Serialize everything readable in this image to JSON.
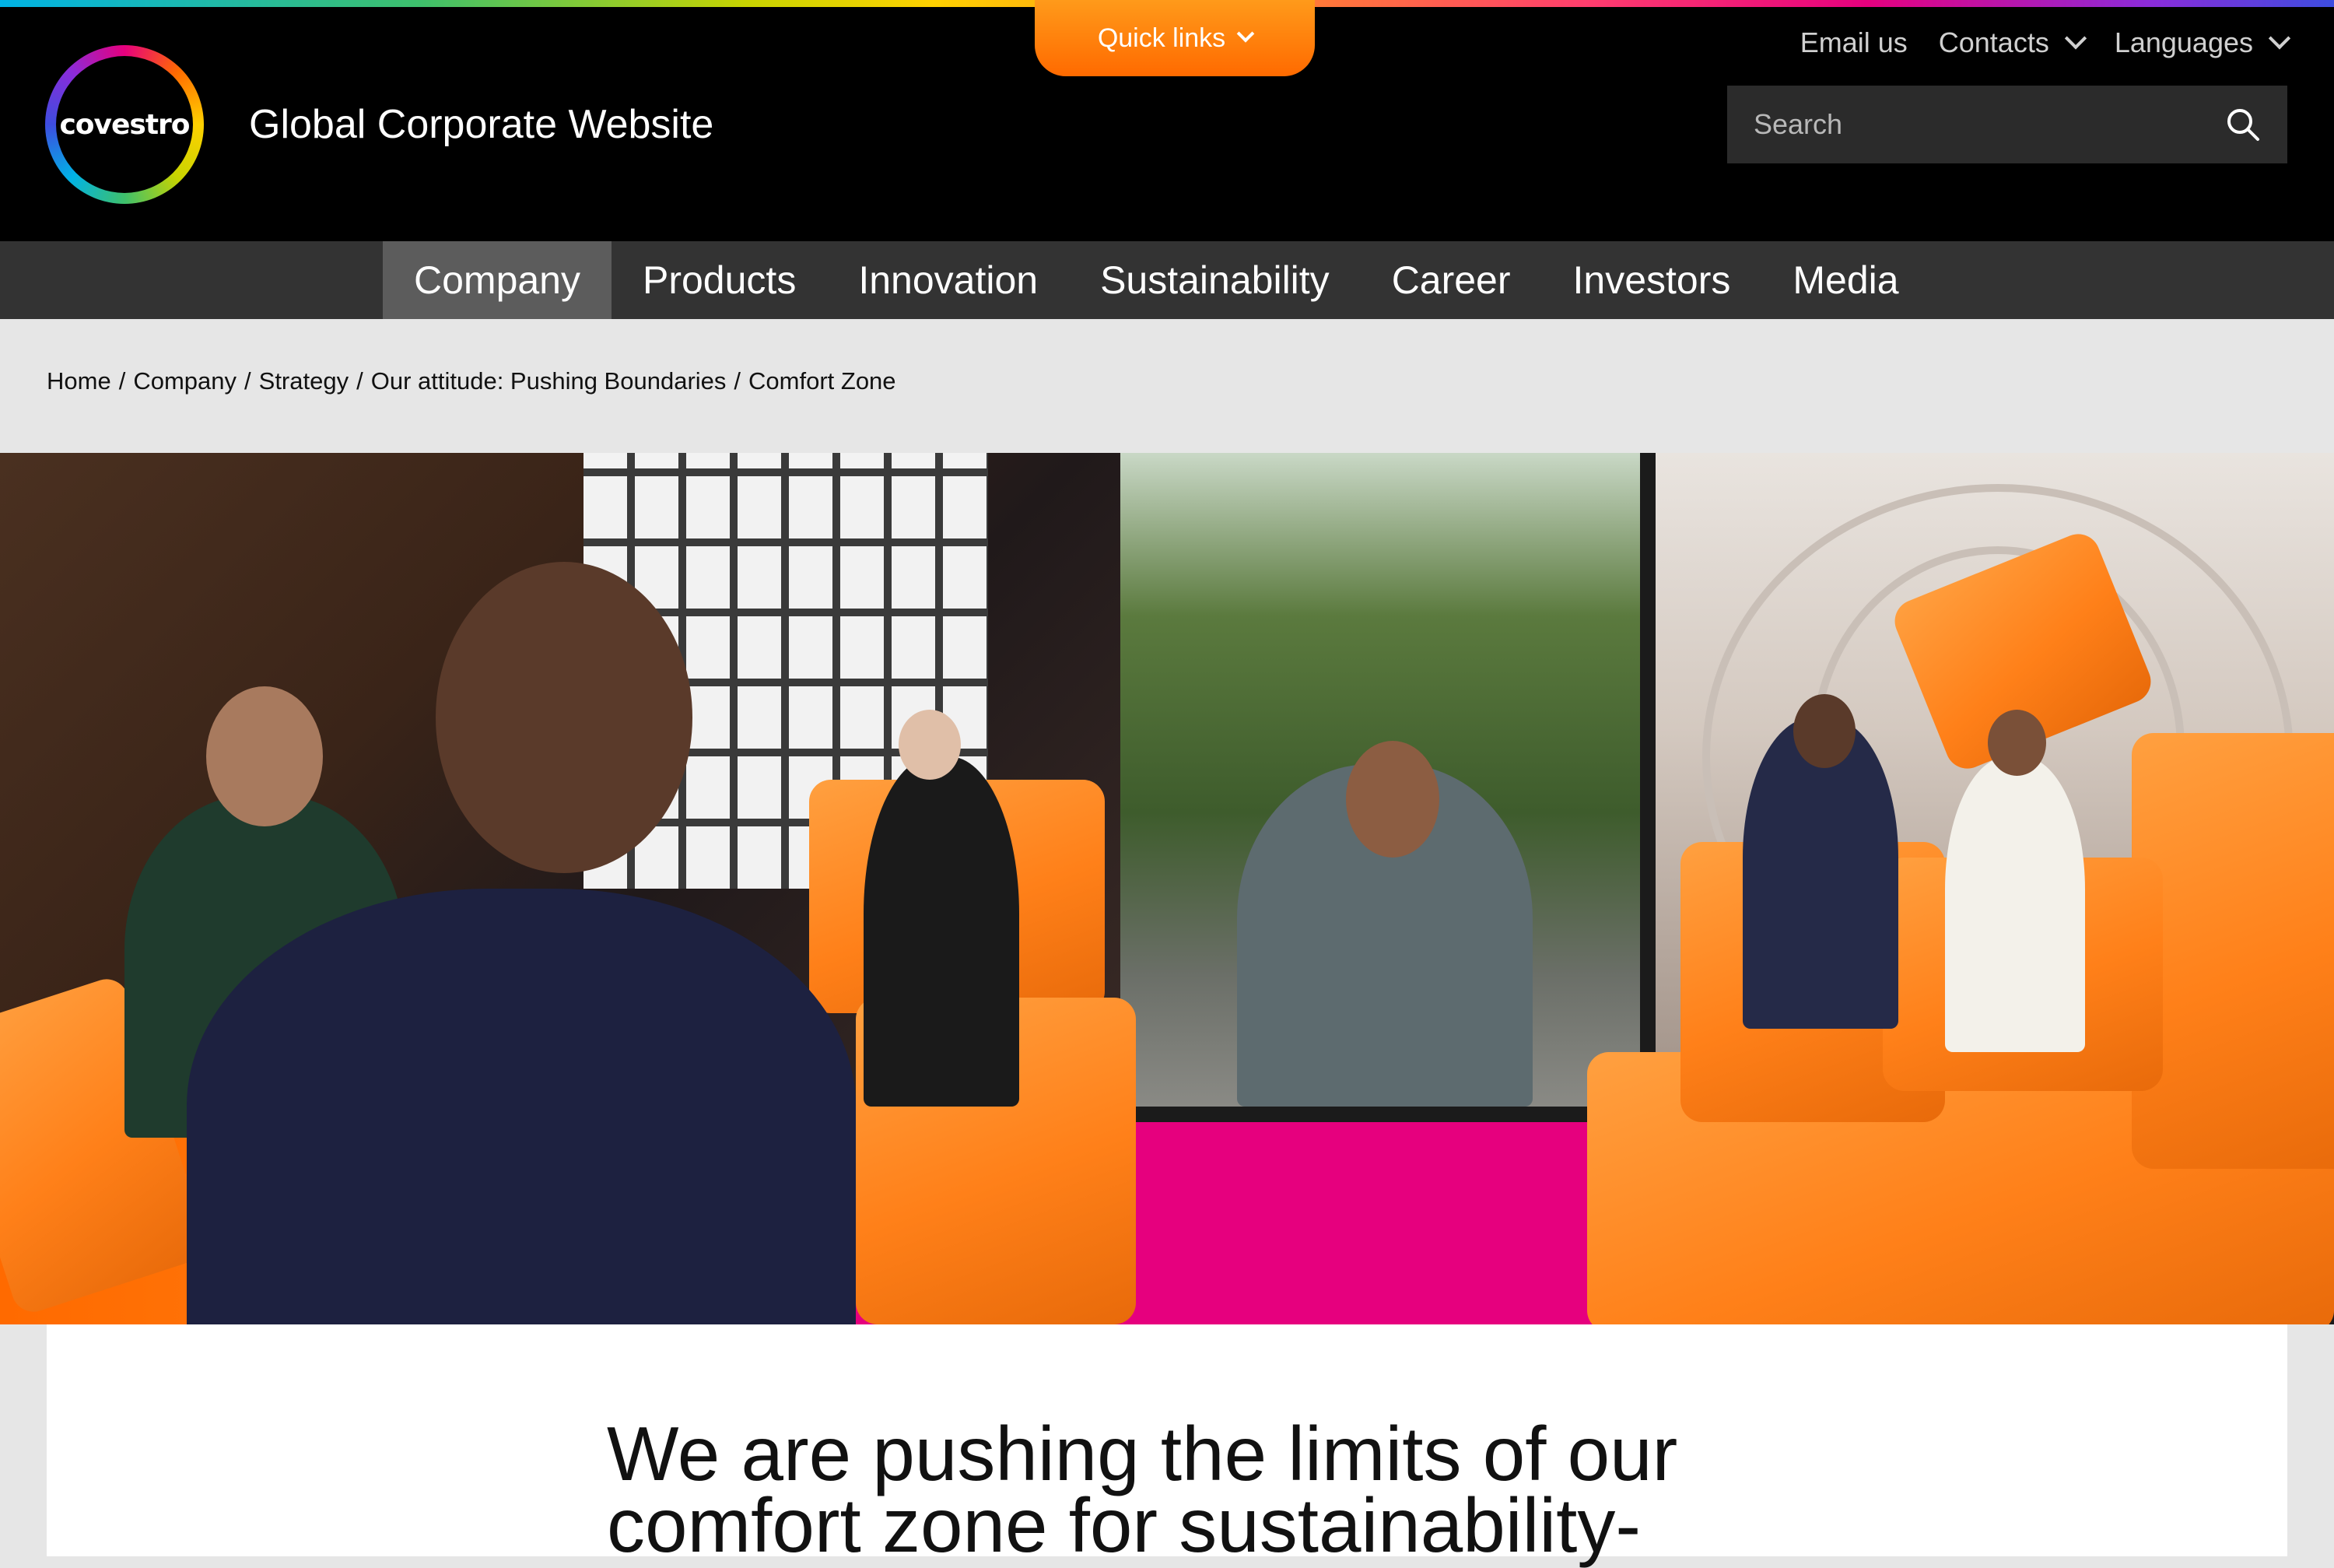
{
  "header": {
    "logo_text": "covestro",
    "site_title": "Global Corporate Website",
    "quick_links_label": "Quick links",
    "top_links": {
      "email": "Email us",
      "contacts": "Contacts",
      "languages": "Languages"
    },
    "search": {
      "placeholder": "Search"
    }
  },
  "nav": {
    "items": [
      {
        "label": "Company",
        "active": true
      },
      {
        "label": "Products"
      },
      {
        "label": "Innovation"
      },
      {
        "label": "Sustainability"
      },
      {
        "label": "Career"
      },
      {
        "label": "Investors"
      },
      {
        "label": "Media"
      }
    ]
  },
  "breadcrumb": {
    "items": [
      "Home",
      "Company",
      "Strategy",
      "Our attitude: Pushing Boundaries",
      "Comfort Zone"
    ],
    "separator": "/"
  },
  "content": {
    "headline": "We are pushing the limits of our comfort zone for sustainability-"
  },
  "colors": {
    "header_bg": "#000000",
    "nav_bg": "#333333",
    "nav_active_bg": "#5c5c5c",
    "accent_orange": "#ff6a00",
    "accent_pink": "#e6007e"
  },
  "icons": {
    "search": "search-icon",
    "chevron": "chevron-down-icon"
  }
}
